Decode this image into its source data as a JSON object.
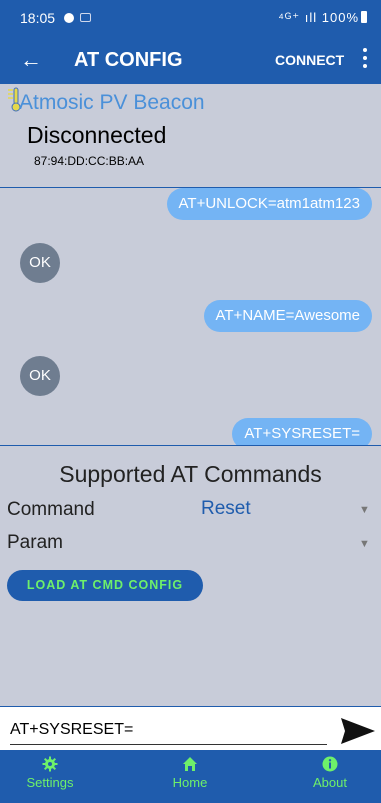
{
  "status_bar": {
    "time": "18:05",
    "indicators": "⁴ᴳ⁺ ıll",
    "battery": "100%"
  },
  "app_bar": {
    "title": "AT CONFIG",
    "back_icon": "arrow-left-icon",
    "connect_label": "CONNECT",
    "menu_icon": "more-vert-icon"
  },
  "device": {
    "name": "Atmosic PV Beacon",
    "status": "Disconnected",
    "mac": "87:94:DD:CC:BB:AA"
  },
  "chat": {
    "messages": [
      {
        "direction": "out",
        "text": "AT+UNLOCK=atm1atm123"
      },
      {
        "direction": "in",
        "text": "OK"
      },
      {
        "direction": "out",
        "text": "AT+NAME=Awesome"
      },
      {
        "direction": "in",
        "text": "OK"
      },
      {
        "direction": "out",
        "text": "AT+SYSRESET="
      }
    ]
  },
  "commands": {
    "title": "Supported AT Commands",
    "command_label": "Command",
    "command_value": "Reset",
    "param_label": "Param",
    "param_value": "",
    "load_button": "LOAD AT CMD CONFIG"
  },
  "input": {
    "value": "AT+SYSRESET="
  },
  "nav": {
    "items": [
      {
        "label": "Settings",
        "icon": "gear-icon"
      },
      {
        "label": "Home",
        "icon": "home-icon"
      },
      {
        "label": "About",
        "icon": "info-icon"
      }
    ]
  },
  "colors": {
    "primary": "#1f5cad",
    "accent_green": "#6ef06a",
    "bubble_out": "#74b4f4",
    "bubble_in": "#6f7d90",
    "background": "#c8ccd9"
  }
}
